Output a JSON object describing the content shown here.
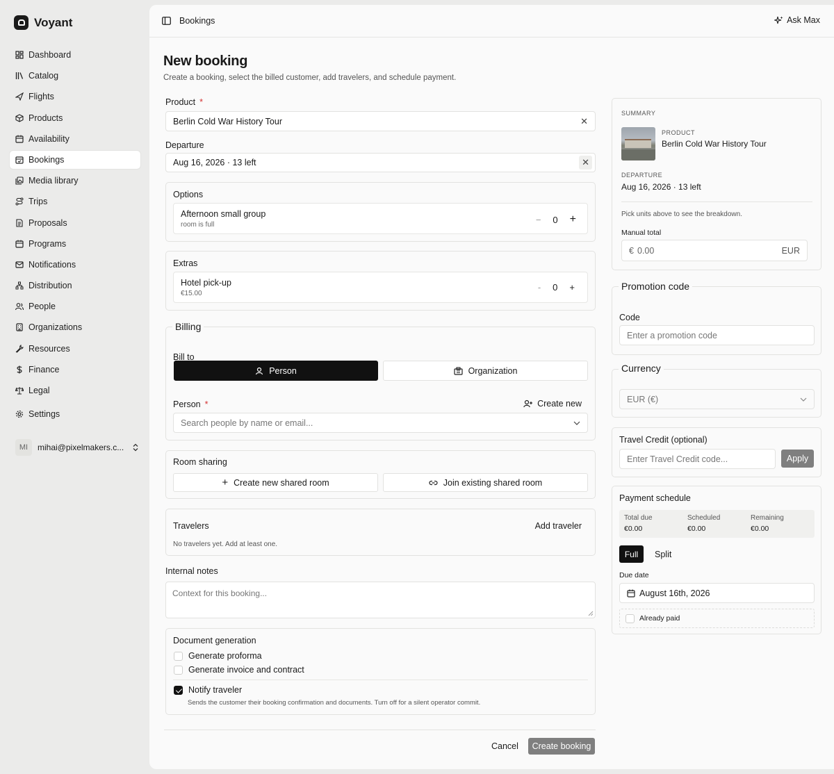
{
  "app": {
    "name": "Voyant"
  },
  "sidebar": {
    "items": [
      {
        "label": "Dashboard",
        "icon": "dashboard-icon"
      },
      {
        "label": "Catalog",
        "icon": "catalog-icon"
      },
      {
        "label": "Flights",
        "icon": "plane-icon"
      },
      {
        "label": "Products",
        "icon": "box-icon"
      },
      {
        "label": "Availability",
        "icon": "calendar-icon"
      },
      {
        "label": "Bookings",
        "icon": "calendar-check-icon",
        "active": true
      },
      {
        "label": "Media library",
        "icon": "images-icon"
      },
      {
        "label": "Trips",
        "icon": "route-icon"
      },
      {
        "label": "Proposals",
        "icon": "document-icon"
      },
      {
        "label": "Programs",
        "icon": "calendar-icon"
      },
      {
        "label": "Notifications",
        "icon": "mail-icon"
      },
      {
        "label": "Distribution",
        "icon": "network-icon"
      },
      {
        "label": "People",
        "icon": "users-icon"
      },
      {
        "label": "Organizations",
        "icon": "building-icon"
      },
      {
        "label": "Resources",
        "icon": "wrench-icon"
      },
      {
        "label": "Finance",
        "icon": "dollar-icon"
      },
      {
        "label": "Legal",
        "icon": "scale-icon"
      }
    ],
    "settings_label": "Settings",
    "user": {
      "initials": "MI",
      "email": "mihai@pixelmakers.c..."
    }
  },
  "topbar": {
    "breadcrumb": "Bookings",
    "ask_label": "Ask Max"
  },
  "page": {
    "title": "New booking",
    "subtitle": "Create a booking, select the billed customer, add travelers, and schedule payment."
  },
  "form": {
    "product_label": "Product",
    "product_value": "Berlin Cold War History Tour",
    "departure_label": "Departure",
    "departure_value": "Aug 16, 2026 · 13 left",
    "options": {
      "title": "Options",
      "item_name": "Afternoon small group",
      "item_note": "room is full",
      "quantity": "0"
    },
    "extras": {
      "title": "Extras",
      "item_name": "Hotel pick-up",
      "item_price": "€15.00",
      "quantity": "0"
    },
    "billing": {
      "title": "Billing",
      "bill_to_label": "Bill to",
      "person_tab": "Person",
      "organization_tab": "Organization",
      "person_label": "Person",
      "create_new": "Create new",
      "search_placeholder": "Search people by name or email..."
    },
    "room_sharing": {
      "title": "Room sharing",
      "create_label": "Create new shared room",
      "join_label": "Join existing shared room"
    },
    "travelers": {
      "title": "Travelers",
      "add_label": "Add traveler",
      "empty": "No travelers yet. Add at least one."
    },
    "notes": {
      "label": "Internal notes",
      "placeholder": "Context for this booking..."
    },
    "documents": {
      "title": "Document generation",
      "proforma": "Generate proforma",
      "invoice": "Generate invoice and contract",
      "notify": "Notify traveler",
      "notify_note": "Sends the customer their booking confirmation and documents. Turn off for a silent operator commit."
    },
    "cancel_label": "Cancel",
    "submit_label": "Create booking"
  },
  "summary": {
    "heading": "SUMMARY",
    "product_label": "PRODUCT",
    "product_value": "Berlin Cold War History Tour",
    "departure_label": "DEPARTURE",
    "departure_value": "Aug 16, 2026 · 13 left",
    "hint": "Pick units above to see the breakdown.",
    "manual_total_label": "Manual total",
    "manual_total_symbol": "€",
    "manual_total_value": "0.00",
    "manual_total_currency": "EUR"
  },
  "promotion": {
    "title": "Promotion code",
    "code_label": "Code",
    "placeholder": "Enter a promotion code"
  },
  "currency": {
    "title": "Currency",
    "value": "EUR (€)"
  },
  "travel_credit": {
    "title": "Travel Credit (optional)",
    "placeholder": "Enter Travel Credit code...",
    "apply_label": "Apply"
  },
  "payment": {
    "title": "Payment schedule",
    "total_due_label": "Total due",
    "total_due": "€0.00",
    "scheduled_label": "Scheduled",
    "scheduled": "€0.00",
    "remaining_label": "Remaining",
    "remaining": "€0.00",
    "full_label": "Full",
    "split_label": "Split",
    "due_date_label": "Due date",
    "due_date": "August 16th, 2026",
    "already_paid": "Already paid"
  },
  "colors": {
    "accent": "#111111",
    "required": "#d43333",
    "background": "#ebebea"
  }
}
